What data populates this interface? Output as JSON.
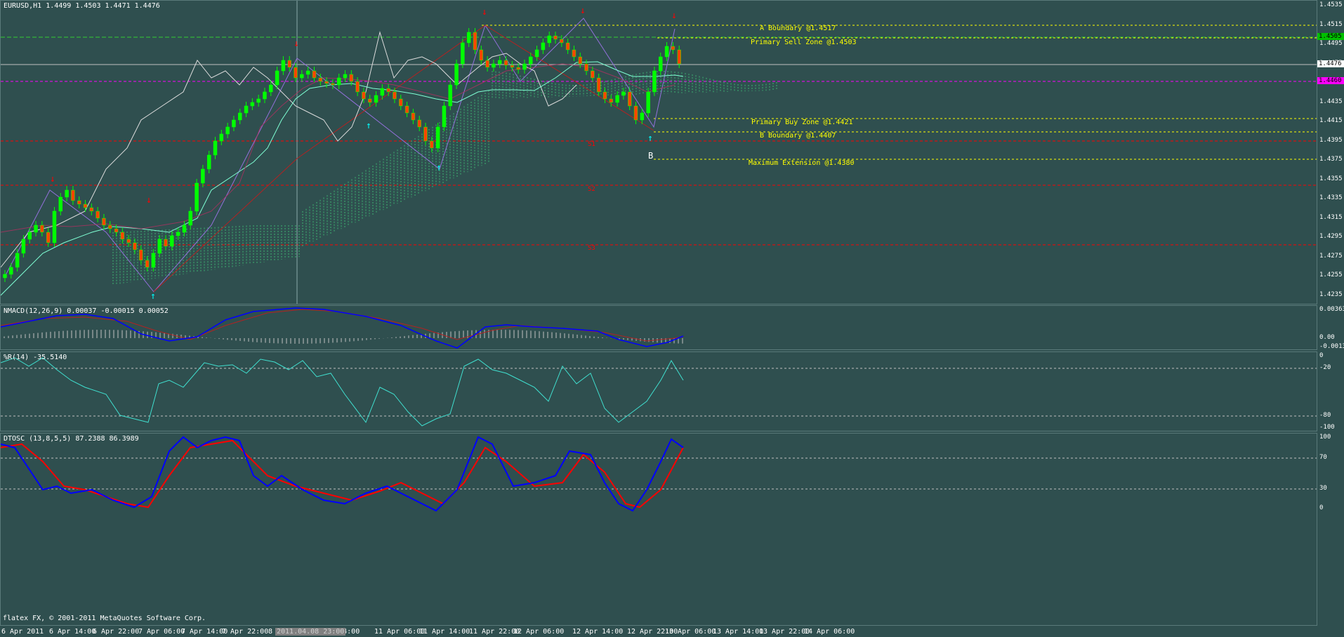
{
  "main": {
    "title": "EURUSD,H1  1.4499 1.4503 1.4471 1.4476",
    "price_ticks": [
      "1.4535",
      "1.4515",
      "1.4495",
      "1.4475",
      "1.4455",
      "1.4435",
      "1.4415",
      "1.4395",
      "1.4375",
      "1.4355",
      "1.4335",
      "1.4315",
      "1.4295",
      "1.4275",
      "1.4255",
      "1.4235"
    ],
    "current_price_badge": "1.4476",
    "sell_badge": "1.4505",
    "magenta_badge": "1.4460",
    "annotations": {
      "a_boundary": "A Boundary @1.4517",
      "primary_sell": "Primary Sell Zone @1.4503",
      "primary_buy": "Primary Buy Zone @1.4421",
      "b_boundary": "B Boundary @1.4407",
      "max_extension": "Maximum Extension @1.4380",
      "s1": "S1",
      "s2": "S2",
      "s3": "S3",
      "point_b": "B"
    }
  },
  "macd": {
    "title": "NMACD(12,26,9) 0.00037 -0.00015 0.00052",
    "ticks": [
      "0.00363",
      "0.00",
      "-0.00134"
    ]
  },
  "wpr": {
    "title": "%R(14) -35.5140",
    "ticks": [
      "0",
      "-20",
      "-80",
      "-100"
    ]
  },
  "dtosc": {
    "title": "DTOSC (13,8,5,5) 87.2388 86.3989",
    "ticks": [
      "100",
      "70",
      "30",
      "0"
    ]
  },
  "time_labels": [
    "6 Apr 2011",
    "6 Apr 14:00",
    "6 Apr 22:00",
    "7 Apr 06:00",
    "7 Apr 14:00",
    "7 Apr 22:00",
    "8 Apr 06:00",
    "8 Apr 14:00",
    "11 Apr 06:00",
    "11 Apr 14:00",
    "11 Apr 22:00",
    "12 Apr 06:00",
    "12 Apr 14:00",
    "12 Apr 22:00",
    "13 Apr 06:00",
    "13 Apr 14:00",
    "13 Apr 22:00",
    "14 Apr 06:00"
  ],
  "cursor_time": "2011.04.08 23:00",
  "copyright": "flatex FX, © 2001-2011 MetaQuotes Software Corp.",
  "colors": {
    "background": "#2f4f4f",
    "bull": "#00ff00",
    "bear": "#ff4500",
    "annotation": "#ffff00",
    "pivot": "#ff0000",
    "macd": "#0000ff",
    "signal": "#ff0000"
  }
}
